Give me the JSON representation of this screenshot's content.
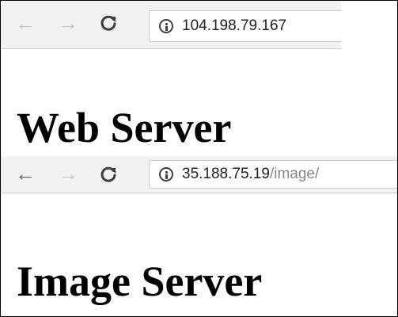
{
  "windows": [
    {
      "toolbar": {
        "back_icon": "back-arrow-icon",
        "forward_icon": "forward-arrow-icon",
        "reload_icon": "reload-icon",
        "site_info_icon": "info-icon",
        "url_host": "104.198.79.167",
        "url_path": ""
      },
      "page": {
        "heading": "Web Server"
      }
    },
    {
      "toolbar": {
        "back_icon": "back-arrow-icon",
        "forward_icon": "forward-arrow-icon",
        "reload_icon": "reload-icon",
        "site_info_icon": "info-icon",
        "url_host": "35.188.75.19",
        "url_path": "/image/"
      },
      "page": {
        "heading": "Image Server"
      }
    }
  ],
  "colors": {
    "toolbar_bg": "#f2f2f2",
    "disabled_nav": "#c4c4c4",
    "enabled_nav": "#5f6368",
    "url_path": "#80868b",
    "heading": "#000000"
  }
}
